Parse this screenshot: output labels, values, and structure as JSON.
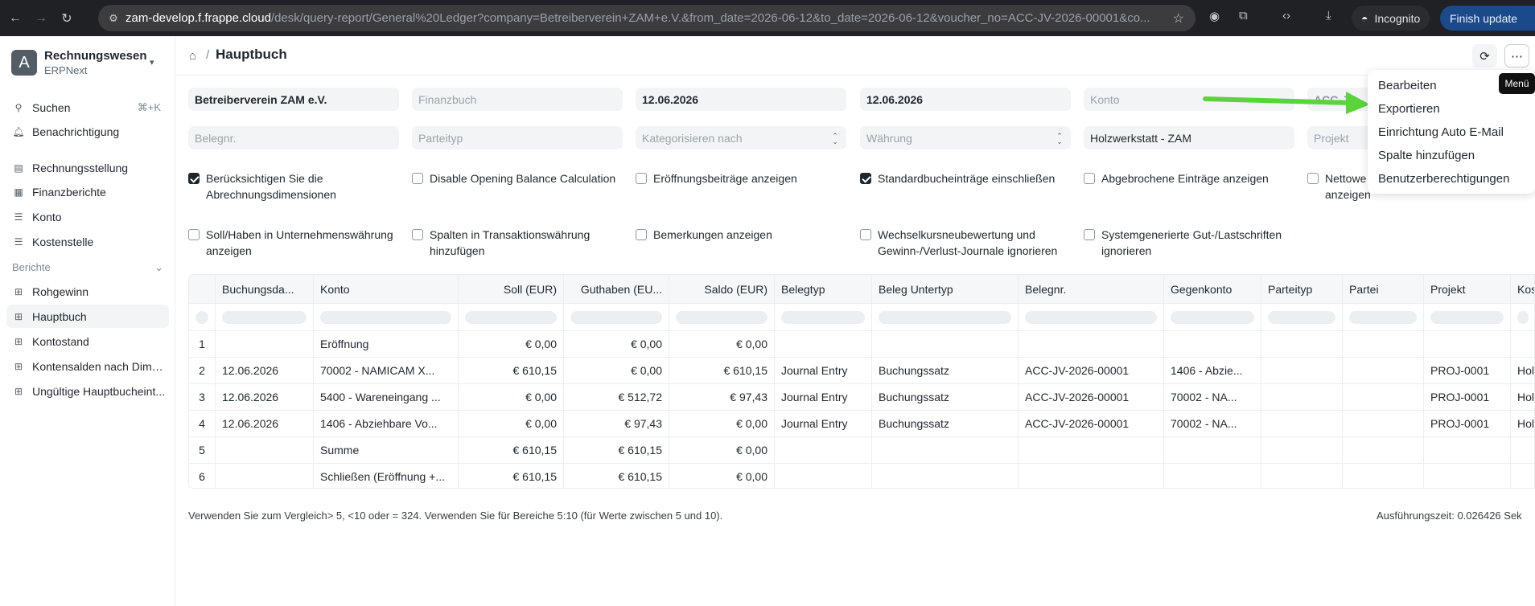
{
  "browser": {
    "url_host": "zam-develop.f.frappe.cloud",
    "url_rest": "/desk/query-report/General%20Ledger?company=Betreiberverein+ZAM+e.V.&from_date=2026-06-12&to_date=2026-06-12&voucher_no=ACC-JV-2026-00001&co...",
    "incognito_label": "Incognito",
    "finish_update_label": "Finish update"
  },
  "sidebar": {
    "workspace_title": "Rechnungswesen",
    "workspace_sub": "ERPNext",
    "avatar_letter": "A",
    "search_label": "Suchen",
    "search_shortcut": "⌘+K",
    "notification_label": "Benachrichtigung",
    "items": [
      {
        "label": "Rechnungsstellung",
        "icon": "invoice-icon"
      },
      {
        "label": "Finanzberichte",
        "icon": "report-icon"
      },
      {
        "label": "Konto",
        "icon": "list-icon"
      },
      {
        "label": "Kostenstelle",
        "icon": "list-icon"
      }
    ],
    "section_label": "Berichte",
    "reports": [
      {
        "label": "Rohgewinn",
        "active": false
      },
      {
        "label": "Hauptbuch",
        "active": true
      },
      {
        "label": "Kontostand",
        "active": false
      },
      {
        "label": "Kontensalden nach Dime...",
        "active": false
      },
      {
        "label": "Ungültige Hauptbucheint...",
        "active": false
      }
    ]
  },
  "header": {
    "title": "Hauptbuch",
    "tooltip": "Menü"
  },
  "filters": {
    "company": "Betreiberverein ZAM e.V.",
    "finance_book_ph": "Finanzbuch",
    "from_date": "12.06.2026",
    "to_date": "12.06.2026",
    "account_ph": "Konto",
    "voucher_partial": "ACC-JV",
    "voucher_no_ph": "Belegnr.",
    "party_type_ph": "Parteityp",
    "group_by_ph": "Kategorisieren nach",
    "currency_ph": "Währung",
    "cost_center": "Holzwerkstatt - ZAM",
    "project_ph": "Projekt"
  },
  "checkboxes": [
    {
      "label": "Berücksichtigen Sie die Abrechnungsdimensionen",
      "checked": true
    },
    {
      "label": "Disable Opening Balance Calculation",
      "checked": false
    },
    {
      "label": "Eröffnungsbeiträge anzeigen",
      "checked": false
    },
    {
      "label": "Standardbucheinträge einschließen",
      "checked": true
    },
    {
      "label": "Abgebrochene Einträge anzeigen",
      "checked": false
    },
    {
      "label": "Nettowe... anzeigen",
      "checked": false
    },
    {
      "label": "Soll/Haben in Unternehmenswährung anzeigen",
      "checked": false
    },
    {
      "label": "Spalten in Transaktionswährung hinzufügen",
      "checked": false
    },
    {
      "label": "Bemerkungen anzeigen",
      "checked": false
    },
    {
      "label": "Wechselkursneubewertung und Gewinn-/Verlust-Journale ignorieren",
      "checked": false
    },
    {
      "label": "Systemgenerierte Gut-/Lastschriften ignorieren",
      "checked": false
    }
  ],
  "checkbox_text": {
    "c0a": "Berücksichtigen Sie die",
    "c0b": "Abrechnungsdimensionen",
    "c1": "Disable Opening Balance Calculation",
    "c2": "Eröffnungsbeiträge anzeigen",
    "c3": "Standardbucheinträge einschließen",
    "c4": "Abgebrochene Einträge anzeigen",
    "c5a": "Nettowe",
    "c5b": "anzeigen",
    "c6a": "Soll/Haben in Unternehmenswährung",
    "c6b": "anzeigen",
    "c7a": "Spalten in Transaktionswährung",
    "c7b": "hinzufügen",
    "c8": "Bemerkungen anzeigen",
    "c9a": "Wechselkursneubewertung und",
    "c9b": "Gewinn-/Verlust-Journale ignorieren",
    "c10a": "Systemgenerierte Gut-/Lastschriften",
    "c10b": "ignorieren"
  },
  "table": {
    "columns": [
      "",
      "Buchungsda...",
      "Konto",
      "Soll (EUR)",
      "Guthaben (EU...",
      "Saldo (EUR)",
      "Belegtyp",
      "Beleg Untertyp",
      "Belegnr.",
      "Gegenkonto",
      "Parteityp",
      "Partei",
      "Projekt",
      "Kost"
    ],
    "rows": [
      [
        "1",
        "",
        "Eröffnung",
        "€ 0,00",
        "€ 0,00",
        "€ 0,00",
        "",
        "",
        "",
        "",
        "",
        "",
        "",
        ""
      ],
      [
        "2",
        "12.06.2026",
        "70002 - NAMICAM X...",
        "€ 610,15",
        "€ 0,00",
        "€ 610,15",
        "Journal Entry",
        "Buchungssatz",
        "ACC-JV-2026-00001",
        "1406 - Abzie...",
        "",
        "",
        "PROJ-0001",
        "Holz"
      ],
      [
        "3",
        "12.06.2026",
        "5400 - Wareneingang ...",
        "€ 0,00",
        "€ 512,72",
        "€ 97,43",
        "Journal Entry",
        "Buchungssatz",
        "ACC-JV-2026-00001",
        "70002 - NA...",
        "",
        "",
        "PROJ-0001",
        "Holz"
      ],
      [
        "4",
        "12.06.2026",
        "1406 - Abziehbare Vo...",
        "€ 0,00",
        "€ 97,43",
        "€ 0,00",
        "Journal Entry",
        "Buchungssatz",
        "ACC-JV-2026-00001",
        "70002 - NA...",
        "",
        "",
        "PROJ-0001",
        "Holz"
      ],
      [
        "5",
        "",
        "Summe",
        "€ 610,15",
        "€ 610,15",
        "€ 0,00",
        "",
        "",
        "",
        "",
        "",
        "",
        "",
        ""
      ],
      [
        "6",
        "",
        "Schließen (Eröffnung +...",
        "€ 610,15",
        "€ 610,15",
        "€ 0,00",
        "",
        "",
        "",
        "",
        "",
        "",
        "",
        ""
      ]
    ]
  },
  "footer": {
    "note": "Verwenden Sie zum Vergleich> 5, <10 oder = 324. Verwenden Sie für Bereiche 5:10 (für Werte zwischen 5 und 10).",
    "exec_time": "Ausführungszeit: 0.026426 Sek"
  },
  "menu": {
    "items": [
      "Bearbeiten",
      "Exportieren",
      "Einrichtung Auto E-Mail",
      "Spalte hinzufügen",
      "Benutzerberechtigungen"
    ]
  },
  "colors": {
    "arrow": "#5ad43a",
    "finish_update_bg": "#1b4a8a"
  }
}
